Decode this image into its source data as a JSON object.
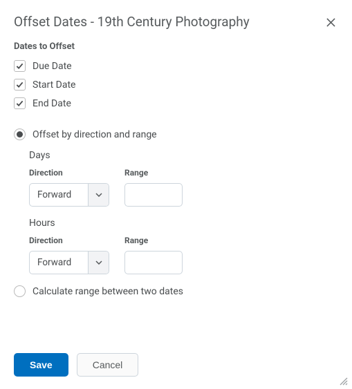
{
  "header": {
    "title": "Offset Dates - 19th Century Photography"
  },
  "section_label": "Dates to Offset",
  "checkboxes": {
    "due_date": "Due Date",
    "start_date": "Start Date",
    "end_date": "End Date"
  },
  "radios": {
    "offset_by_direction": "Offset by direction and range",
    "calculate_range": "Calculate range between two dates"
  },
  "days": {
    "title": "Days",
    "direction_label": "Direction",
    "range_label": "Range",
    "direction_value": "Forward",
    "range_value": ""
  },
  "hours": {
    "title": "Hours",
    "direction_label": "Direction",
    "range_label": "Range",
    "direction_value": "Forward",
    "range_value": ""
  },
  "footer": {
    "save": "Save",
    "cancel": "Cancel"
  }
}
